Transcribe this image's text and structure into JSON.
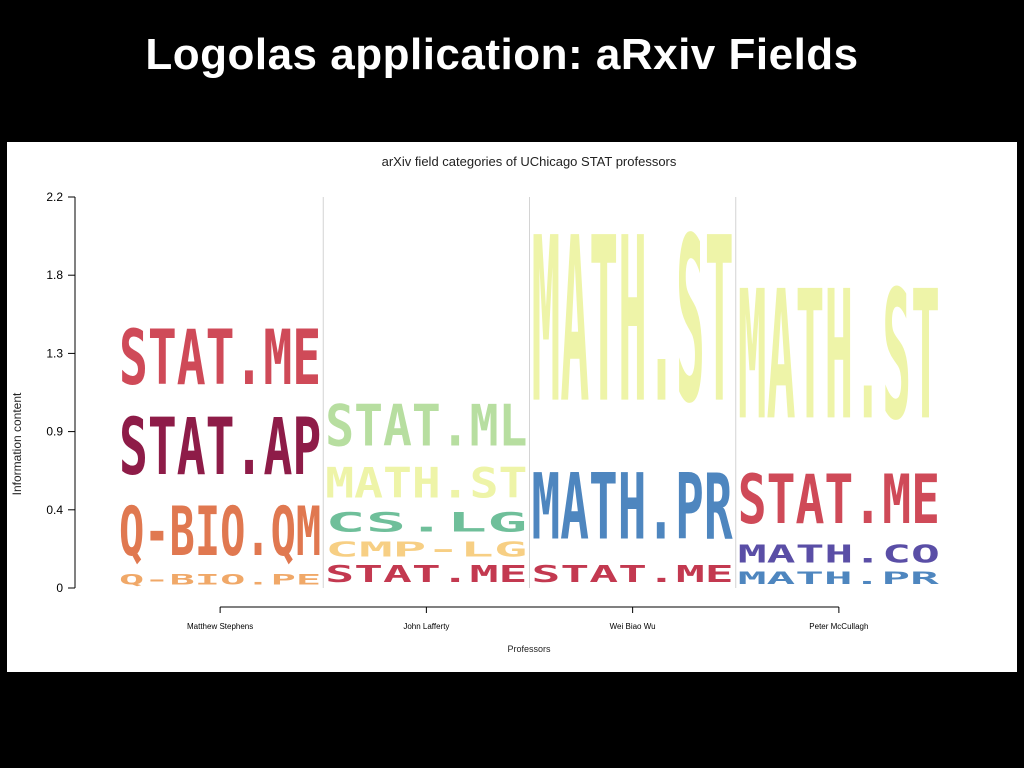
{
  "slide": {
    "title": "Logolas application: aRxiv Fields"
  },
  "chart_data": {
    "type": "logo-stacked-bar",
    "title": "arXiv field categories of UChicago STAT professors",
    "xlabel": "Professors",
    "ylabel": "Information content",
    "ylim": [
      0,
      2.2
    ],
    "yticks": [
      "0",
      "0.4",
      "0.9",
      "1.3",
      "1.8",
      "2.2"
    ],
    "ytick_values": [
      0,
      0.44,
      0.88,
      1.32,
      1.76,
      2.2
    ],
    "grid": false,
    "categories": [
      "Matthew Stephens",
      "John Lafferty",
      "Wei Biao Wu",
      "Peter McCullagh"
    ],
    "stacks": [
      {
        "professor": "Matthew Stephens",
        "segments": [
          {
            "label": "Q-BIO.PE",
            "value": 0.09,
            "color": "#f0a868"
          },
          {
            "label": "Q-BIO.QM",
            "value": 0.44,
            "color": "#e07850"
          },
          {
            "label": "STAT.AP",
            "value": 0.51,
            "color": "#8e1c48"
          },
          {
            "label": "STAT.ME",
            "value": 0.49,
            "color": "#cf4a58"
          }
        ]
      },
      {
        "professor": "John Lafferty",
        "segments": [
          {
            "label": "STAT.ME",
            "value": 0.15,
            "color": "#c33950"
          },
          {
            "label": "CMP-LG",
            "value": 0.13,
            "color": "#f7cf84"
          },
          {
            "label": "CS.LG",
            "value": 0.17,
            "color": "#6fbf9a"
          },
          {
            "label": "MATH.ST",
            "value": 0.27,
            "color": "#eef4a8"
          },
          {
            "label": "STAT.ML",
            "value": 0.37,
            "color": "#b7dea0"
          }
        ]
      },
      {
        "professor": "Wei Biao Wu",
        "segments": [
          {
            "label": "STAT.ME",
            "value": 0.15,
            "color": "#c33950"
          },
          {
            "label": "MATH.PR",
            "value": 0.59,
            "color": "#4e86bf"
          },
          {
            "label": "MATH.ST",
            "value": 1.47,
            "color": "#eef4a8"
          }
        ]
      },
      {
        "professor": "Peter McCullagh",
        "segments": [
          {
            "label": "MATH.PR",
            "value": 0.11,
            "color": "#4e86bf"
          },
          {
            "label": "MATH.CO",
            "value": 0.16,
            "color": "#5a4ea6"
          },
          {
            "label": "STAT.ME",
            "value": 0.44,
            "color": "#cf4a58"
          },
          {
            "label": "MATH.ST",
            "value": 1.15,
            "color": "#eef4a8"
          }
        ]
      }
    ]
  }
}
